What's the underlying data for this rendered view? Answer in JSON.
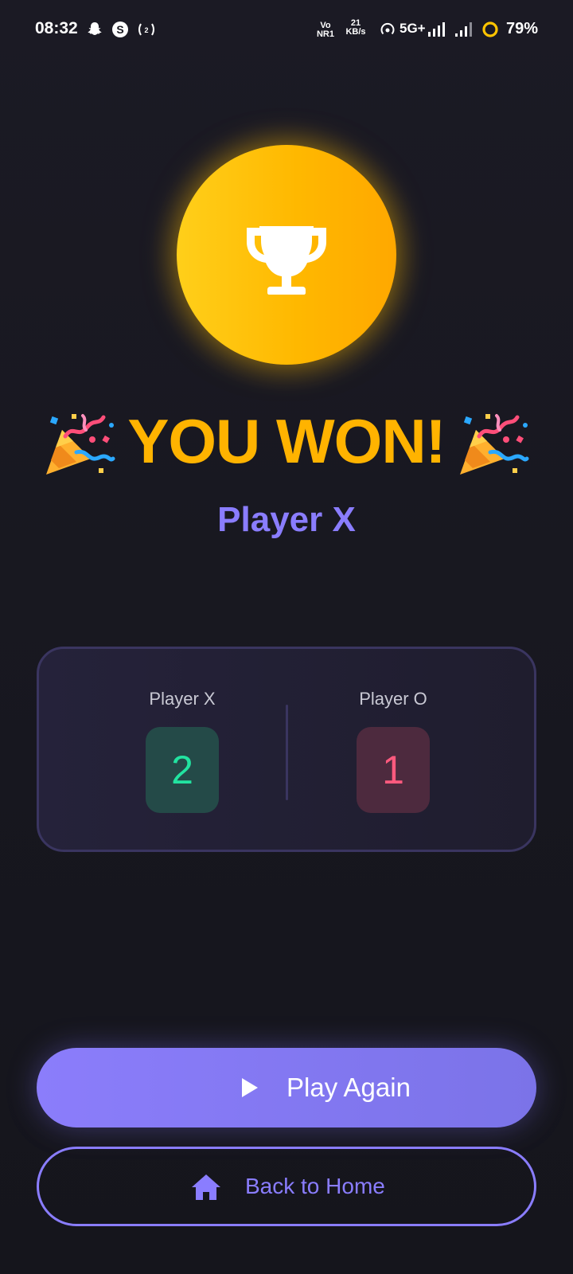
{
  "status_bar": {
    "time": "08:32",
    "volte_top": "Vo",
    "volte_bottom": "NR1",
    "speed_value": "21",
    "speed_unit": "KB/s",
    "network": "5G+",
    "battery": "79%"
  },
  "result": {
    "title": "YOU WON!",
    "winner": "Player X"
  },
  "scoreboard": {
    "players": [
      {
        "label": "Player X",
        "score": "2",
        "color": "#22e3a0"
      },
      {
        "label": "Player O",
        "score": "1",
        "color": "#ff5a7e"
      }
    ]
  },
  "actions": {
    "play_again": "Play Again",
    "back_home": "Back to Home"
  },
  "icons": {
    "trophy": "trophy-icon",
    "party": "party-popper-icon",
    "play": "play-icon",
    "home": "home-icon"
  },
  "colors": {
    "accent": "#8a7dff",
    "gold": "#ffb300",
    "background": "#17171f"
  }
}
